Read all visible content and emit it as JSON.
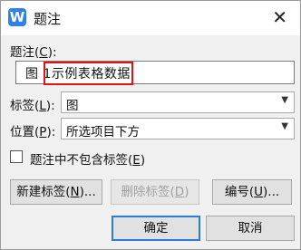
{
  "window": {
    "title": "题注",
    "close_glyph": "✕",
    "app_icon": "W"
  },
  "caption": {
    "label": "题注(",
    "key": "C",
    "label_end": "):",
    "value": "图 1示例表格数据"
  },
  "tag": {
    "label": "标签(",
    "key": "L",
    "label_end": "):",
    "selected": "图"
  },
  "position": {
    "label": "位置(",
    "key": "P",
    "label_end": "):",
    "selected": "所选项目下方"
  },
  "exclude": {
    "label": "题注中不包含标签(",
    "key": "E",
    "label_end": ")",
    "checked": false
  },
  "buttons": {
    "new_tag": {
      "label": "新建标签(",
      "key": "N",
      "label_end": ")..."
    },
    "delete_tag": {
      "label": "删除标签(",
      "key": "D",
      "label_end": ")"
    },
    "numbering": {
      "label": "编号(",
      "key": "U",
      "label_end": ")..."
    },
    "ok": "确定",
    "cancel": "取消"
  },
  "colors": {
    "highlight": "#e81010",
    "app_icon": "#2f80ed"
  }
}
